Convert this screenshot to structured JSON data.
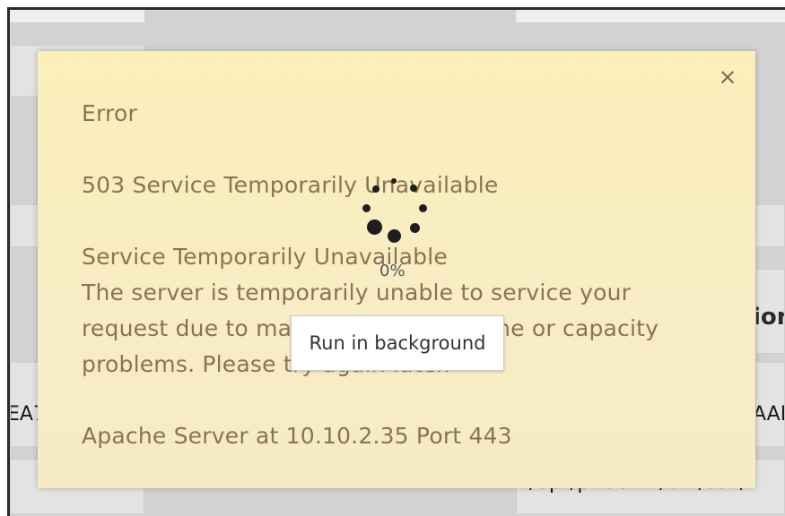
{
  "background": {
    "edge_texts": {
      "right_mid": "ior",
      "left_row": "EA7",
      "right_row": "AAB",
      "right_bottom": "/opt/phoenix/bin/ssh/i"
    }
  },
  "dialog": {
    "close_symbol": "×",
    "title": "Error",
    "heading": "503 Service Temporarily Unavailable",
    "subheading": "Service Temporarily Unavailable",
    "body_lines": [
      "The server is temporarily unable to service your",
      "request due to maintenance downtime or capacity",
      "problems. Please try again later."
    ],
    "footer": "Apache Server at 10.10.2.35 Port 443"
  },
  "loader": {
    "progress_text": "0%",
    "run_in_background_label": "Run in background"
  },
  "colors": {
    "dialog_background": "#f8edc4",
    "dialog_text": "#8a7452",
    "overlay": "#d2d2d2"
  }
}
